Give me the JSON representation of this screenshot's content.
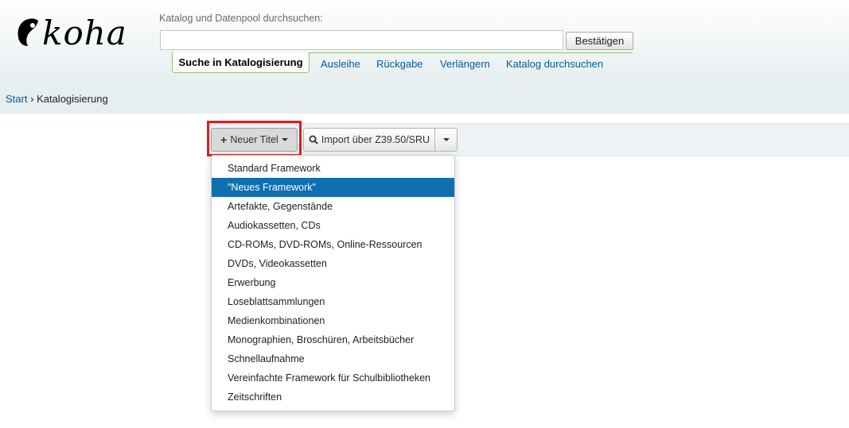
{
  "logo": {
    "text": "koha"
  },
  "search": {
    "label": "Katalog und Datenpool durchsuchen:",
    "value": "",
    "placeholder": "",
    "submit_label": "Bestätigen"
  },
  "tabs": {
    "active": "Suche in Katalogisierung",
    "links": [
      "Ausleihe",
      "Rückgabe",
      "Verlängern",
      "Katalog durchsuchen"
    ]
  },
  "breadcrumb": {
    "home": "Start",
    "separator": "›",
    "current": "Katalogisierung"
  },
  "toolbar": {
    "new_record_label": "Neuer Titel",
    "z3950_label": "Import über Z39.50/SRU"
  },
  "framework_menu": {
    "items": [
      "Standard Framework",
      "\"Neues Framework\"",
      "Artefakte, Gegenstände",
      "Audiokassetten, CDs",
      "CD-ROMs, DVD-ROMs, Online-Ressourcen",
      "DVDs, Videokassetten",
      "Erwerbung",
      "Loseblattsammlungen",
      "Medienkombinationen",
      "Monographien, Broschüren, Arbeitsbücher",
      "Schnellaufnahme",
      "Vereinfachte Framework für Schulbibliotheken",
      "Zeitschriften"
    ],
    "highlighted_index": 1
  },
  "colors": {
    "link": "#005a9c",
    "tab_border": "#92c26a",
    "menu_highlight": "#0f6fb1",
    "annotation_box": "#e01b1b"
  },
  "icons": {
    "new_record": "plus-icon",
    "z3950": "search-icon",
    "dropdown": "caret-down-icon"
  }
}
